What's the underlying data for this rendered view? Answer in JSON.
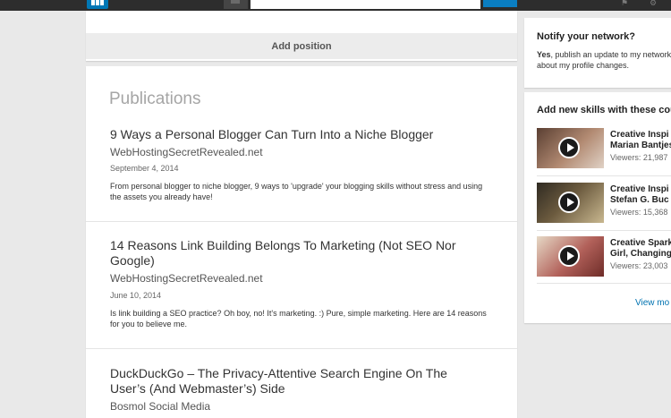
{
  "topbar": {
    "search": {
      "placeholder": ""
    },
    "icons": [
      "flag-icon",
      "gear-icon"
    ]
  },
  "experience": {
    "add_position_label": "Add position"
  },
  "publications": {
    "section_title": "Publications",
    "items": [
      {
        "title": "9 Ways a Personal Blogger Can Turn Into a Niche Blogger",
        "publisher": "WebHostingSecretRevealed.net",
        "date": "September 4, 2014",
        "description": "From personal blogger to niche blogger, 9 ways to 'upgrade' your blogging skills without stress and using the assets you already have!"
      },
      {
        "title": "14 Reasons Link Building Belongs To Marketing (Not SEO Nor Google)",
        "publisher": "WebHostingSecretRevealed.net",
        "date": "June 10, 2014",
        "description": "Is link building a SEO practice? Oh boy, no! It's marketing. :) Pure, simple marketing. Here are 14 reasons for you to believe me."
      },
      {
        "title": "DuckDuckGo – The Privacy-Attentive Search Engine On The User’s (And Webmaster’s) Side",
        "publisher": "Bosmol Social Media",
        "date": "",
        "description": ""
      }
    ]
  },
  "notify": {
    "title": "Notify your network?",
    "yes": "Yes",
    "text": ", publish an update to my network about my profile changes."
  },
  "skills": {
    "title": "Add new skills with these cou",
    "courses": [
      {
        "name_line1": "Creative Inspi",
        "name_line2": "Marian Bantjes",
        "viewers": "Viewers: 21,987",
        "thumb_color": "#8c6a55"
      },
      {
        "name_line1": "Creative Inspi",
        "name_line2": "Stefan G. Buc",
        "viewers": "Viewers: 15,368",
        "thumb_color": "#6b5a3e"
      },
      {
        "name_line1": "Creative Spark",
        "name_line2": "Girl, Changing",
        "viewers": "Viewers: 23,003",
        "thumb_color": "#b2615a"
      }
    ],
    "view_more": "View mo"
  },
  "colors": {
    "accent": "#0077b5",
    "link": "#0073b1",
    "topbar": "#2d2d2d"
  }
}
